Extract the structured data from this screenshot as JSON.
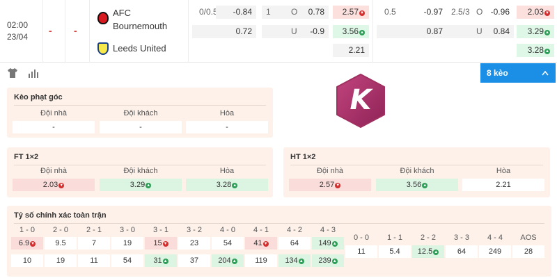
{
  "match": {
    "time": "02:00",
    "date": "23/04",
    "score_home": "-",
    "score_away": "-",
    "home_team_line1": "AFC",
    "home_team_line2": "Bournemouth",
    "away_team": "Leeds United"
  },
  "odds_ft": {
    "hdp_line": "0/0.5",
    "hdp_home": "-0.84",
    "hdp_away": "0.72",
    "ou_line": "1",
    "ou_o_label": "O",
    "ou_over": "0.78",
    "ou_u_label": "U",
    "ou_under": "-0.9",
    "x12_home": "2.57",
    "x12_away": "3.56",
    "x12_draw": "2.21"
  },
  "odds_ht": {
    "hdp_line": "0.5",
    "hdp_home": "-0.97",
    "hdp_away": "0.87",
    "ou_line": "2.5/3",
    "ou_o_label": "O",
    "ou_over": "-0.96",
    "ou_u_label": "U",
    "ou_under": "0.84",
    "x12_home": "2.03",
    "x12_away": "3.29",
    "x12_draw": "3.28"
  },
  "toolbar": {
    "keo_label": "8 kèo",
    "chevron": "^"
  },
  "logo_letter": "K",
  "corner": {
    "title": "Kèo phạt góc",
    "headers": [
      "Đội nhà",
      "Đội khách",
      "Hòa"
    ],
    "values": [
      "-",
      "-",
      "-"
    ]
  },
  "ft": {
    "title": "FT 1×2",
    "headers": [
      "Đội nhà",
      "Đội khách",
      "Hòa"
    ],
    "values": [
      "2.03",
      "3.29",
      "3.28"
    ]
  },
  "ht": {
    "title": "HT 1×2",
    "headers": [
      "Đội nhà",
      "Đội khách",
      "Hòa"
    ],
    "values": [
      "2.57",
      "3.56",
      "2.21"
    ]
  },
  "correct_score": {
    "title": "Tỷ số chính xác toàn trận",
    "home_wins": [
      {
        "score": "1 - 0",
        "odds": "6.9",
        "trend": "down"
      },
      {
        "score": "2 - 0",
        "odds": "9.5",
        "trend": ""
      },
      {
        "score": "2 - 1",
        "odds": "7",
        "trend": ""
      },
      {
        "score": "3 - 0",
        "odds": "19",
        "trend": ""
      },
      {
        "score": "3 - 1",
        "odds": "15",
        "trend": "down"
      },
      {
        "score": "3 - 2",
        "odds": "23",
        "trend": ""
      },
      {
        "score": "4 - 0",
        "odds": "54",
        "trend": ""
      },
      {
        "score": "4 - 1",
        "odds": "41",
        "trend": "down"
      },
      {
        "score": "4 - 2",
        "odds": "64",
        "trend": ""
      },
      {
        "score": "4 - 3",
        "odds": "149",
        "trend": "up"
      }
    ],
    "away_wins": [
      {
        "odds": "10",
        "trend": ""
      },
      {
        "odds": "19",
        "trend": ""
      },
      {
        "odds": "11",
        "trend": ""
      },
      {
        "odds": "54",
        "trend": ""
      },
      {
        "odds": "31",
        "trend": "up"
      },
      {
        "odds": "37",
        "trend": ""
      },
      {
        "odds": "204",
        "trend": "up"
      },
      {
        "odds": "119",
        "trend": ""
      },
      {
        "odds": "134",
        "trend": "up"
      },
      {
        "odds": "239",
        "trend": "up"
      }
    ],
    "draws": [
      {
        "score": "0 - 0",
        "odds": "11",
        "trend": ""
      },
      {
        "score": "1 - 1",
        "odds": "5.4",
        "trend": ""
      },
      {
        "score": "2 - 2",
        "odds": "12.5",
        "trend": "up"
      },
      {
        "score": "3 - 3",
        "odds": "64",
        "trend": ""
      },
      {
        "score": "4 - 4",
        "odds": "249",
        "trend": ""
      },
      {
        "score": "AOS",
        "odds": "28",
        "trend": ""
      }
    ]
  },
  "colors": {
    "accent": "#1b8ee6",
    "panel_bg": "#fdf1ea",
    "down_bg": "#fadcda",
    "up_bg": "#dcf5e3",
    "logo_main": "#b0336e"
  }
}
